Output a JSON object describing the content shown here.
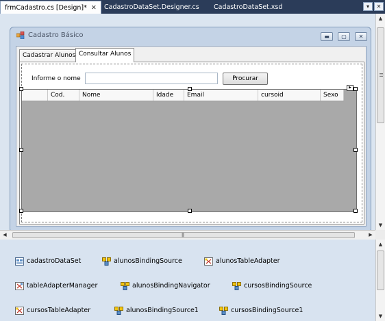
{
  "document_tabs": [
    {
      "label": "frmCadastro.cs [Design]*",
      "close": "✕",
      "active": true
    },
    {
      "label": "CadastroDataSet.Designer.cs",
      "active": false
    },
    {
      "label": "CadastroDataSet.xsd",
      "active": false
    }
  ],
  "form": {
    "title": "Cadastro Básico",
    "minimize": "▬",
    "maximize": "▢",
    "close": "✕"
  },
  "tabs": [
    {
      "label": "Cadastrar Alunos",
      "selected": false
    },
    {
      "label": "Consultar Alunos",
      "selected": true
    }
  ],
  "search": {
    "label": "Informe o nome",
    "value": "",
    "button": "Procurar"
  },
  "grid": {
    "columns": [
      "Cod.",
      "Nome",
      "Idade",
      "Email",
      "cursoid",
      "Sexo"
    ]
  },
  "tray_components": [
    {
      "name": "cadastroDataSet",
      "icon": "dataset-icon"
    },
    {
      "name": "alunosBindingSource",
      "icon": "binding-source-icon"
    },
    {
      "name": "alunosTableAdapter",
      "icon": "table-adapter-icon"
    },
    {
      "name": "tableAdapterManager",
      "icon": "table-adapter-manager-icon"
    },
    {
      "name": "alunosBindingNavigator",
      "icon": "binding-navigator-icon"
    },
    {
      "name": "cursosBindingSource",
      "icon": "binding-source-icon"
    },
    {
      "name": "cursosTableAdapter",
      "icon": "table-adapter-icon"
    },
    {
      "name": "alunosBindingSource1",
      "icon": "binding-source-icon"
    },
    {
      "name": "cursosBindingSource1",
      "icon": "binding-source-icon"
    }
  ],
  "colors": {
    "tab_strip": "#2b3c59",
    "designer_bg": "#dbe5f0",
    "form_frame": "#c4d3e6",
    "grid_bg": "#a9a9a9"
  }
}
